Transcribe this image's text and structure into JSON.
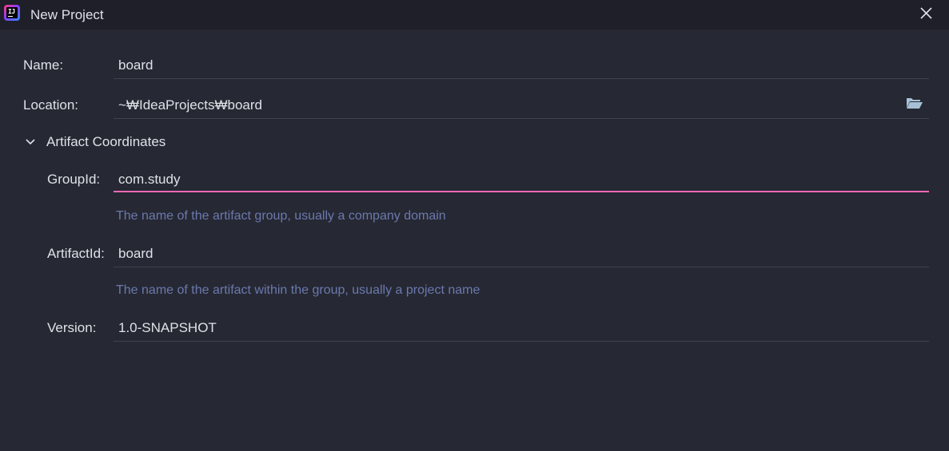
{
  "window": {
    "title": "New Project",
    "app_icon": "intellij-idea-logo",
    "app_icon_text": "IJ"
  },
  "form": {
    "name": {
      "label": "Name:",
      "value": "board"
    },
    "location": {
      "label": "Location:",
      "value": "~₩IdeaProjects₩board",
      "icon": "folder-icon"
    },
    "artifact_section": {
      "title": "Artifact Coordinates",
      "expanded": true,
      "group_id": {
        "label": "GroupId:",
        "value": "com.study",
        "hint": "The name of the artifact group, usually a company domain"
      },
      "artifact_id": {
        "label": "ArtifactId:",
        "value": "board",
        "hint": "The name of the artifact within the group, usually a project name"
      },
      "version": {
        "label": "Version:",
        "value": "1.0-SNAPSHOT"
      }
    }
  },
  "colors": {
    "background": "#262833",
    "titlebar": "#1e1f28",
    "text": "#dfe1e8",
    "hint": "#6b79ad",
    "focus_underline": "#f06bb4",
    "underline": "#3f4250"
  }
}
